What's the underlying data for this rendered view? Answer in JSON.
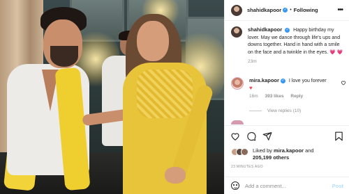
{
  "post": {
    "author": "shahidkapoor",
    "follow_label": "Following",
    "dot": "•",
    "more": "•••"
  },
  "caption": {
    "username": "shahidkapoor",
    "text": "Happy birthday my lover. May we dance through life's ups and downs together. Hand in hand with a smile on the face and a twinkle in the eyes. 💗 💗",
    "time": "23m"
  },
  "comment": {
    "username": "mira.kapoor",
    "text": "I love you forever",
    "heart": "♥",
    "time": "16m",
    "likes": "393 likes",
    "reply_label": "Reply",
    "view_replies": "View replies (10)"
  },
  "likes": {
    "prefix": "Liked by",
    "user": "mira.kapoor",
    "and": "and",
    "others": "205,199 others"
  },
  "timestamp": "23 MINUTES AGO",
  "comment_box": {
    "placeholder": "Add a comment...",
    "post_label": "Post"
  },
  "icons": {
    "like": "heart-icon",
    "comment": "comment-icon",
    "share": "share-icon",
    "save": "bookmark-icon",
    "emoji": "emoji-icon"
  },
  "colors": {
    "verified": "#3897f0",
    "heart": "#ed4956",
    "post_disabled": "#b2dffc",
    "muted_text": "#8e8e8e"
  }
}
